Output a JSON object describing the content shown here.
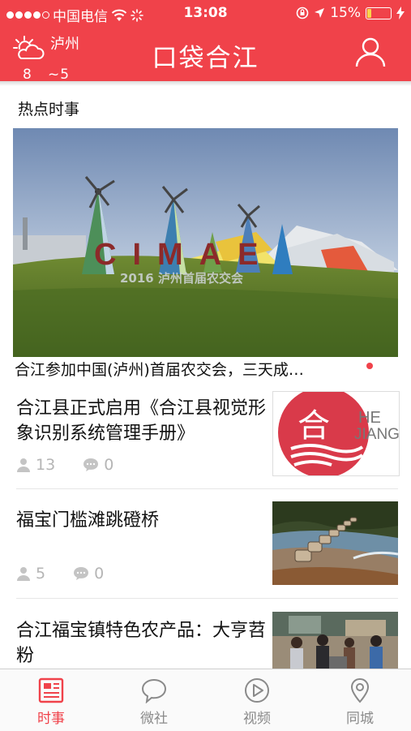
{
  "status_bar": {
    "carrier": "中国电信",
    "time": "13:08",
    "battery": "15%",
    "battery_level": 0.15
  },
  "header": {
    "city": "泸州",
    "temp_low": "8",
    "temp_high": "~5",
    "title": "口袋合江"
  },
  "section_title": "热点时事",
  "hero": {
    "caption": "合江参加中国(泸州)首届农交会，三天成…",
    "sign_text": "CIMAE",
    "sign_sub": "2016 泸州首届农交会"
  },
  "news": [
    {
      "title": "合江县正式启用《合江县视觉形象识别系统管理手册》",
      "views": "13",
      "comments": "0",
      "logo_en_1": "HE",
      "logo_en_2": "JIANG"
    },
    {
      "title": "福宝门槛滩跳磴桥",
      "views": "5",
      "comments": "0"
    },
    {
      "title": "合江福宝镇特色农产品：大亨苕粉"
    }
  ],
  "tabs": [
    {
      "label": "时事",
      "icon": "newspaper-icon",
      "active": true
    },
    {
      "label": "微社",
      "icon": "chat-bubble-icon",
      "active": false
    },
    {
      "label": "视频",
      "icon": "play-circle-icon",
      "active": false
    },
    {
      "label": "同城",
      "icon": "location-pin-icon",
      "active": false
    }
  ],
  "colors": {
    "accent": "#f0424a",
    "meta": "#b5b5b5"
  }
}
